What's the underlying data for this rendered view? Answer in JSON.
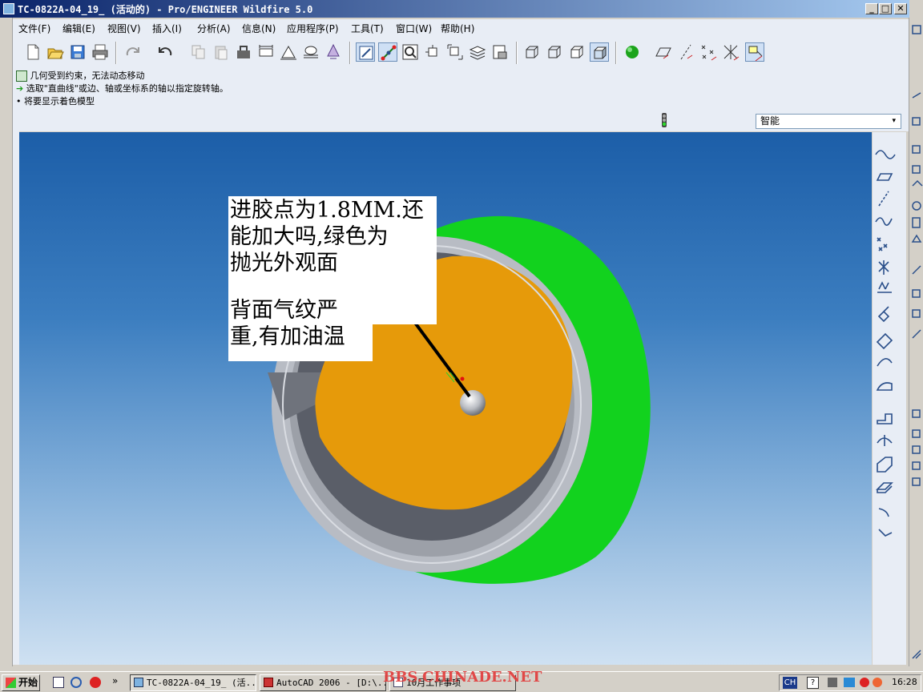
{
  "window": {
    "title": "TC-0822A-04_19_ (活动的) - Pro/ENGINEER Wildfire 5.0",
    "minimize": "_",
    "maximize": "□",
    "close": "✕"
  },
  "menu": [
    "文件(F)",
    "编辑(E)",
    "视图(V)",
    "插入(I)",
    "分析(A)",
    "信息(N)",
    "应用程序(P)",
    "工具(T)",
    "窗口(W)",
    "帮助(H)"
  ],
  "messages": [
    "几何受到约束，无法动态移动",
    "选取\"直曲线\"或边、轴或坐标系的轴以指定旋转轴。",
    "• 将要显示着色模型"
  ],
  "filter": {
    "value": "智能",
    "arrow": "▾"
  },
  "annotation": {
    "line1": "进胶点为1.8MM.还",
    "line2": "能加大吗,绿色为",
    "line3": "抛光外观面",
    "line4": "背面气纹严",
    "line5": "重,有加油温"
  },
  "colors": {
    "body_green": "#12d21e",
    "face_orange": "#e69a0a",
    "rim_gray": "#b8bcc4",
    "inner_dark": "#5a5e68"
  },
  "taskbar": {
    "start": "开始",
    "more": "»",
    "tasks": [
      "TC-0822A-04_19_ (活...",
      "AutoCAD 2006 - [D:\\...",
      "10月工作事项"
    ],
    "ime": "CH",
    "help": "?",
    "clock": "16:28"
  },
  "watermark": "BBS.CHINADE.NET"
}
